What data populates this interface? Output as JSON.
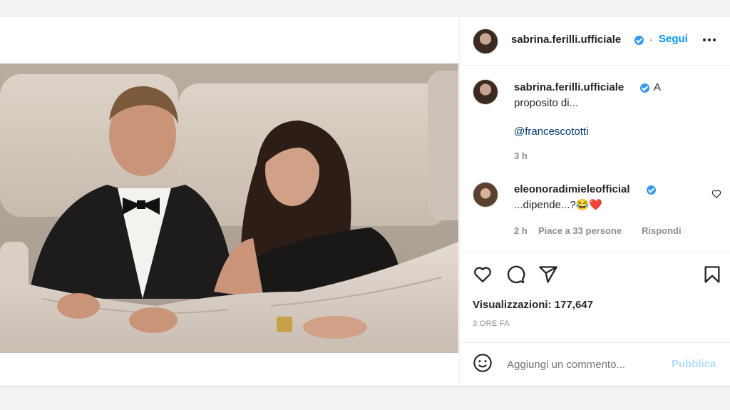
{
  "post": {
    "author": "sabrina.ferilli.ufficiale",
    "follow_separator": "·",
    "follow_label": "Segui",
    "more_label": "•••",
    "caption_line1": "A",
    "caption_line2": "proposito di...",
    "caption_mention": "@francescototti",
    "caption_time": "3 h"
  },
  "comments": [
    {
      "author": "eleonoradimieleofficial",
      "text": "...dipende...?😂❤️",
      "time": "2 h",
      "likes": "Piace a 33 persone",
      "reply": "Rispondi"
    }
  ],
  "stats": {
    "views_label": "Visualizzazioni: 177,647",
    "posted_ago": "3 ORE FA"
  },
  "compose": {
    "placeholder": "Aggiungi un commento...",
    "publish_label": "Pubblica"
  },
  "icons": {
    "like": "heart-icon",
    "comment": "comment-icon",
    "share": "send-icon",
    "save": "bookmark-icon",
    "emoji": "emoji-icon",
    "comment_like": "small-heart-icon"
  },
  "colors": {
    "link_blue": "#0095f6",
    "verified_blue": "#3897f0",
    "mention": "#00376b",
    "muted": "#8e8e8e"
  }
}
